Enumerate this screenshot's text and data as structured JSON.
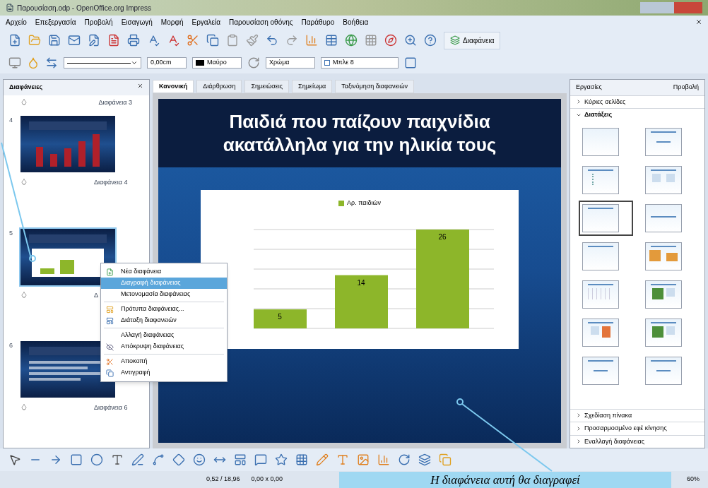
{
  "window": {
    "title": "Παρουσίαση.odp - OpenOffice.org Impress"
  },
  "menu": [
    "Αρχείο",
    "Επεξεργασία",
    "Προβολή",
    "Εισαγωγή",
    "Μορφή",
    "Εργαλεία",
    "Παρουσίαση οθόνης",
    "Παράθυρο",
    "Βοήθεια"
  ],
  "toolbar": {
    "slide_button": "Διαφάνεια"
  },
  "line_toolbar": {
    "width": "0,00cm",
    "line_color": "Μαύρο",
    "fill_type": "Χρώμα",
    "fill_color": "Μπλε 8"
  },
  "slides_panel": {
    "title": "Διαφάνειες",
    "top_label": "Διαφάνεια 3",
    "slides": [
      {
        "number": "4",
        "label": "Διαφάνεια 4",
        "kind": "bars",
        "selected": false
      },
      {
        "number": "5",
        "label": "Δ",
        "kind": "chart",
        "selected": true
      },
      {
        "number": "6",
        "label": "Διαφάνεια 6",
        "kind": "text",
        "selected": false
      }
    ]
  },
  "context_menu": [
    {
      "label": "Νέα διαφάνεια",
      "kind": "new",
      "selected": false,
      "separator_before": false
    },
    {
      "label": "Διαγραφή διαφάνειας",
      "kind": "plain",
      "selected": true,
      "separator_before": false
    },
    {
      "label": "Μετονομασία διαφάνειας",
      "kind": "plain",
      "selected": false,
      "separator_before": false
    },
    {
      "label": "Πρότυπα διαφάνειας...",
      "kind": "template",
      "selected": false,
      "separator_before": true
    },
    {
      "label": "Διάταξη διαφανειών",
      "kind": "layout",
      "selected": false,
      "separator_before": false
    },
    {
      "label": "Αλλαγή διαφάνειας",
      "kind": "plain",
      "selected": false,
      "separator_before": true
    },
    {
      "label": "Απόκρυψη διαφάνειας",
      "kind": "hide",
      "selected": false,
      "separator_before": false
    },
    {
      "label": "Αποκοπή",
      "kind": "cut",
      "selected": false,
      "separator_before": true
    },
    {
      "label": "Αντιγραφή",
      "kind": "copy",
      "selected": false,
      "separator_before": false
    }
  ],
  "view_tabs": [
    {
      "label": "Κανονική",
      "selected": true
    },
    {
      "label": "Διάρθρωση",
      "selected": false
    },
    {
      "label": "Σημειώσεις",
      "selected": false
    },
    {
      "label": "Σημείωμα",
      "selected": false
    },
    {
      "label": "Ταξινόμηση διαφανειών",
      "selected": false
    }
  ],
  "slide": {
    "title": "Παιδιά που παίζουν παιχνίδια ακατάλληλα για την ηλικία τους",
    "chart_data": {
      "type": "bar",
      "series": [
        {
          "name": "Αρ. παιδιών",
          "color": "#8db62a",
          "values": [
            5,
            14,
            26
          ]
        }
      ],
      "data_labels": true
    }
  },
  "tasks_panel": {
    "title": "Εργασίες",
    "view_menu": "Προβολή",
    "sections_top": [
      {
        "label": "Κύριες σελίδες",
        "expanded": false
      },
      {
        "label": "Διατάξεις",
        "expanded": true
      }
    ],
    "layouts": [
      {
        "kind": "blank",
        "selected": false
      },
      {
        "kind": "title",
        "selected": false
      },
      {
        "kind": "list",
        "selected": false
      },
      {
        "kind": "twocol",
        "selected": false
      },
      {
        "kind": "titleonly",
        "selected": true
      },
      {
        "kind": "centered",
        "selected": false
      },
      {
        "kind": "titleonly",
        "selected": false
      },
      {
        "kind": "charts",
        "selected": false
      },
      {
        "kind": "table",
        "selected": false
      },
      {
        "kind": "picture",
        "selected": false
      },
      {
        "kind": "chart",
        "selected": false
      },
      {
        "kind": "picture",
        "selected": false
      },
      {
        "kind": "title",
        "selected": false
      },
      {
        "kind": "title",
        "selected": false
      }
    ],
    "sections_bottom": [
      {
        "label": "Σχεδίαση πίνακα",
        "expanded": false
      },
      {
        "label": "Προσαρμοσμένο εφέ κίνησης",
        "expanded": false
      },
      {
        "label": "Εναλλαγή διαφάνειας",
        "expanded": false
      }
    ]
  },
  "status_bar": {
    "position": "0,52 / 18,96",
    "size": "0,00 x 0,00",
    "zoom": "60%"
  },
  "caption": "Η διαφάνεια αυτή θα διαγραφεί"
}
